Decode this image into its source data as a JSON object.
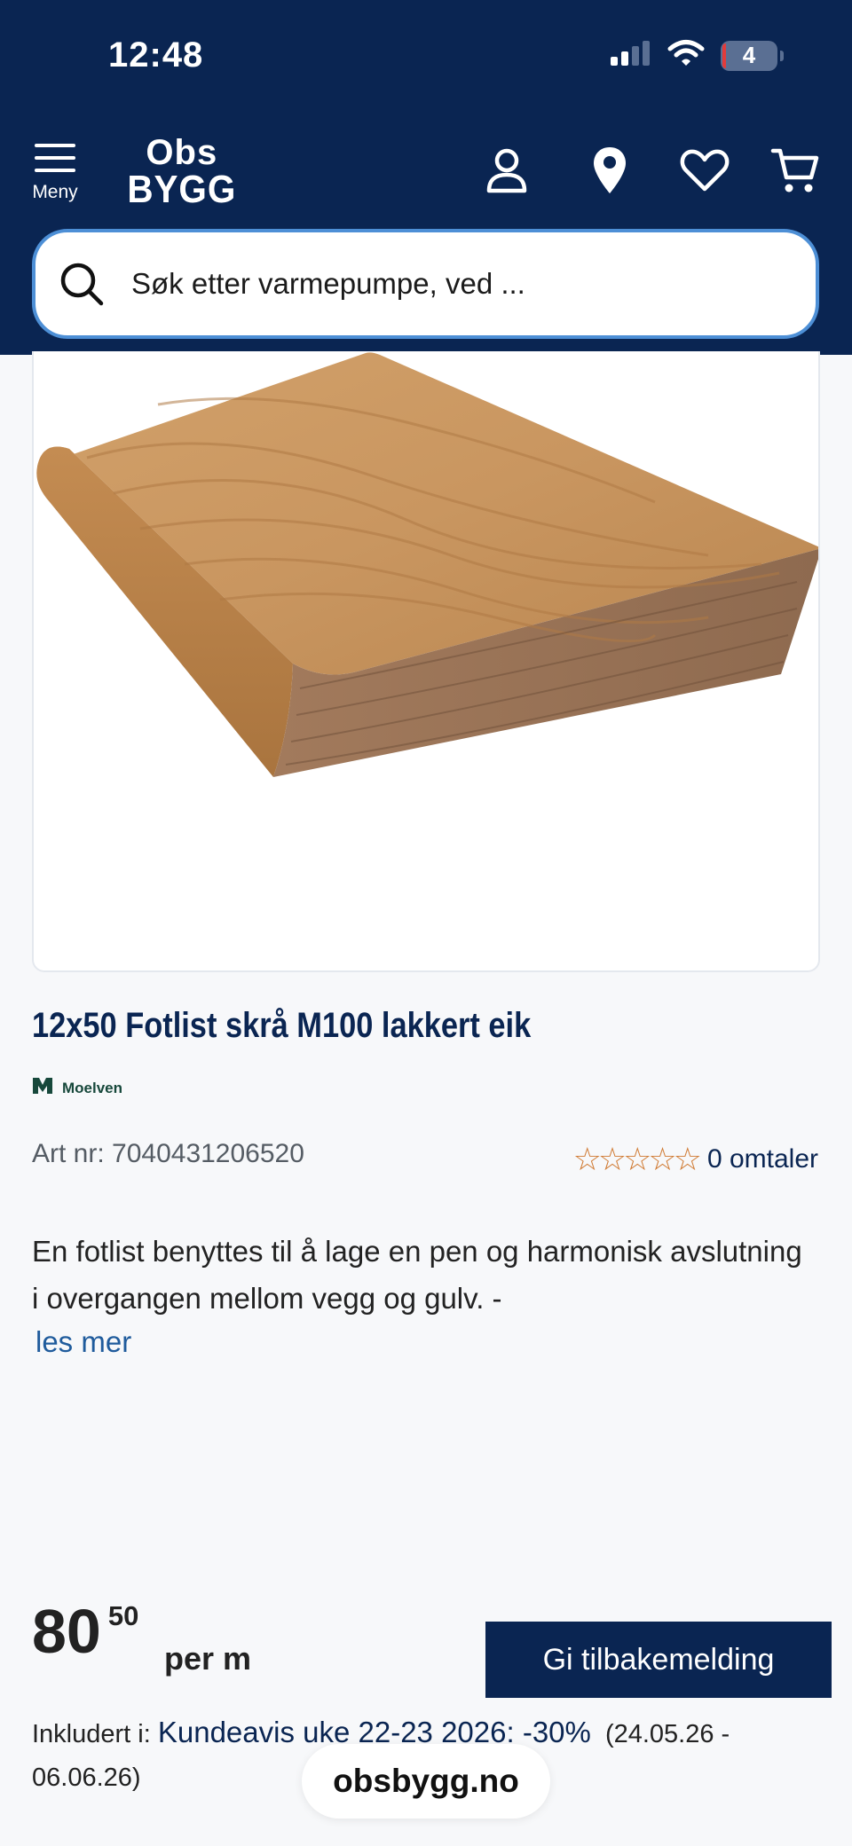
{
  "status_bar": {
    "time": "12:48",
    "battery": "4"
  },
  "header": {
    "menu_label": "Meny",
    "logo_line1": "Obs",
    "logo_line2": "BYGG",
    "search_placeholder": "Søk etter varmepumpe, ved ..."
  },
  "product": {
    "title": "12x50 Fotlist skrå M100 lakkert eik",
    "brand": "Moelven",
    "article_number": "Art nr: 7040431206520",
    "rating": 0,
    "stars": "☆☆☆☆☆",
    "reviews": "0 omtaler",
    "description": "En fotlist benyttes til å lage en pen og harmonisk avslutning i overgangen mellom vegg og gulv. -",
    "read_more": "les mer"
  },
  "pricing": {
    "price_integer": "80",
    "price_decimal": "50",
    "unit": "per m",
    "included_prefix": "Inkludert i:",
    "campaign": "Kundeavis uke 22-23 2026: -30%",
    "period": "(24.05.26 - 06.06.26)"
  },
  "feedback_button": "Gi tilbakemelding",
  "url_bar": "obsbygg.no",
  "colors": {
    "navy": "#0a2552",
    "accent_blue": "#4d8fd6",
    "star": "#d07a32"
  }
}
